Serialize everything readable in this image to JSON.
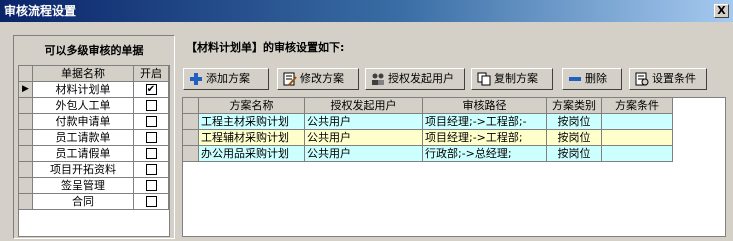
{
  "window": {
    "title": "审核流程设置",
    "close_label": "X"
  },
  "left_panel": {
    "title": "可以多级审核的单据",
    "columns": [
      "单据名称",
      "开启"
    ],
    "current_row_marker": "▶",
    "rows": [
      {
        "name": "材料计划单",
        "enabled": true,
        "checkmark": "✔"
      },
      {
        "name": "外包人工单",
        "enabled": false,
        "checkmark": ""
      },
      {
        "name": "付款申请单",
        "enabled": false,
        "checkmark": ""
      },
      {
        "name": "员工请款单",
        "enabled": false,
        "checkmark": ""
      },
      {
        "name": "员工请假单",
        "enabled": false,
        "checkmark": ""
      },
      {
        "name": "项目开拓资料",
        "enabled": false,
        "checkmark": ""
      },
      {
        "name": "签呈管理",
        "enabled": false,
        "checkmark": ""
      },
      {
        "name": "合同",
        "enabled": false,
        "checkmark": ""
      }
    ]
  },
  "right_panel": {
    "heading": "【材料计划单】的审核设置如下:",
    "toolbar": {
      "add": "添加方案",
      "edit": "修改方案",
      "authorize": "授权发起用户",
      "copy": "复制方案",
      "delete": "删除",
      "conditions": "设置条件"
    },
    "columns": [
      "方案名称",
      "授权发起用户",
      "审核路径",
      "方案类别",
      "方案条件"
    ],
    "rows": [
      {
        "name": "工程主材采购计划",
        "user": "公共用户",
        "path": "项目经理;->工程部;-",
        "category": "按岗位",
        "condition": ""
      },
      {
        "name": "工程辅材采购计划",
        "user": "公共用户",
        "path": "项目经理;->工程部;",
        "category": "按岗位",
        "condition": ""
      },
      {
        "name": "办公用品采购计划",
        "user": "公共用户",
        "path": "行政部;->总经理;",
        "category": "按岗位",
        "condition": ""
      }
    ]
  },
  "colors": {
    "title_bar": "#0a246a",
    "row_highlight_cyan": "#ccffff",
    "row_highlight_yellow": "#ffffcc",
    "face": "#d4d0c8"
  }
}
